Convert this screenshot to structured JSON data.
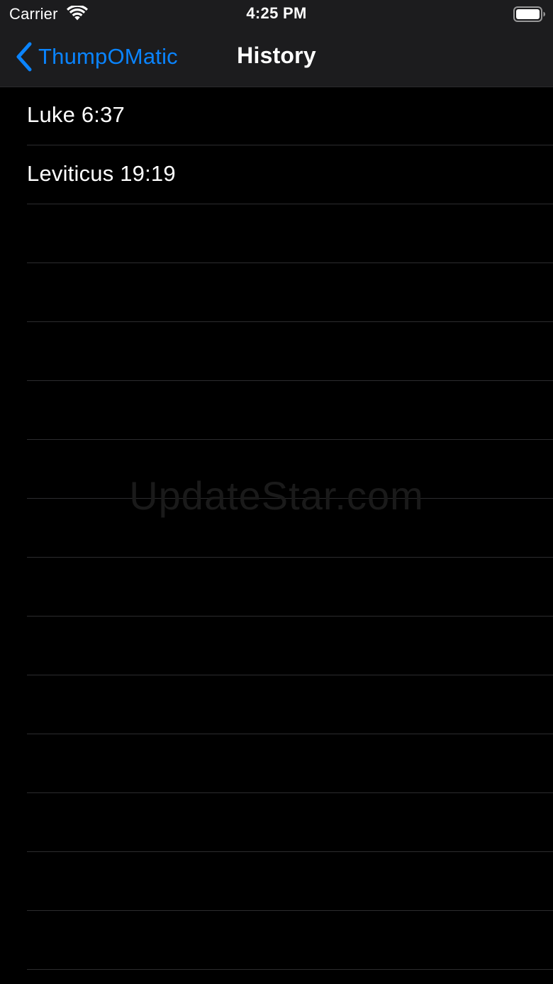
{
  "status_bar": {
    "carrier": "Carrier",
    "time": "4:25 PM",
    "wifi_icon": "wifi-icon",
    "battery_icon": "battery-full-icon"
  },
  "nav": {
    "back_label": "ThumpOMatic",
    "back_icon": "chevron-left-icon",
    "title": "History",
    "accent_color": "#0a84ff"
  },
  "history": {
    "items": [
      {
        "label": "Luke 6:37"
      },
      {
        "label": "Leviticus 19:19"
      }
    ]
  },
  "watermark": "UpdateStar.com",
  "colors": {
    "background": "#000000",
    "bar_background": "#1c1c1e",
    "separator": "#2c2c2e",
    "text": "#ffffff"
  }
}
